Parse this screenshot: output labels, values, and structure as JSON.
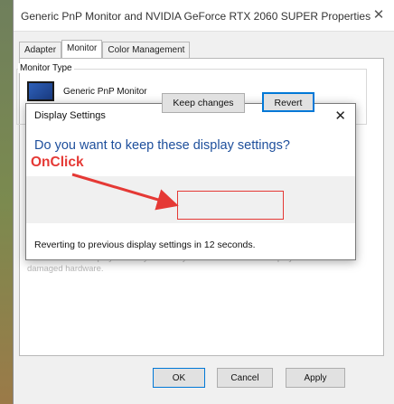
{
  "properties_window": {
    "title": "Generic PnP Monitor and NVIDIA GeForce RTX 2060 SUPER Properties",
    "close_glyph": "✕",
    "tabs": [
      {
        "label": "Adapter",
        "active": false
      },
      {
        "label": "Monitor",
        "active": true
      },
      {
        "label": "Color Management",
        "active": false
      }
    ],
    "monitor_type_label": "Monitor Type",
    "monitor_name": "Generic PnP Monitor",
    "faded_warning": "monitor cannot display correctly. This may lead to an unusable display and/or damaged hardware.",
    "buttons": {
      "ok": "OK",
      "cancel": "Cancel",
      "apply": "Apply"
    }
  },
  "dialog": {
    "title": "Display Settings",
    "close_glyph": "✕",
    "question": "Do you want to keep these display settings?",
    "keep_button": "Keep changes",
    "revert_button": "Revert",
    "footer": "Reverting to previous display settings in 12 seconds."
  },
  "annotation": {
    "text": "OnClick",
    "color": "#e53935"
  },
  "colors": {
    "question_text": "#1e4f9c",
    "focus_border": "#0078d7"
  },
  "icons": {
    "monitor": "monitor-icon"
  }
}
